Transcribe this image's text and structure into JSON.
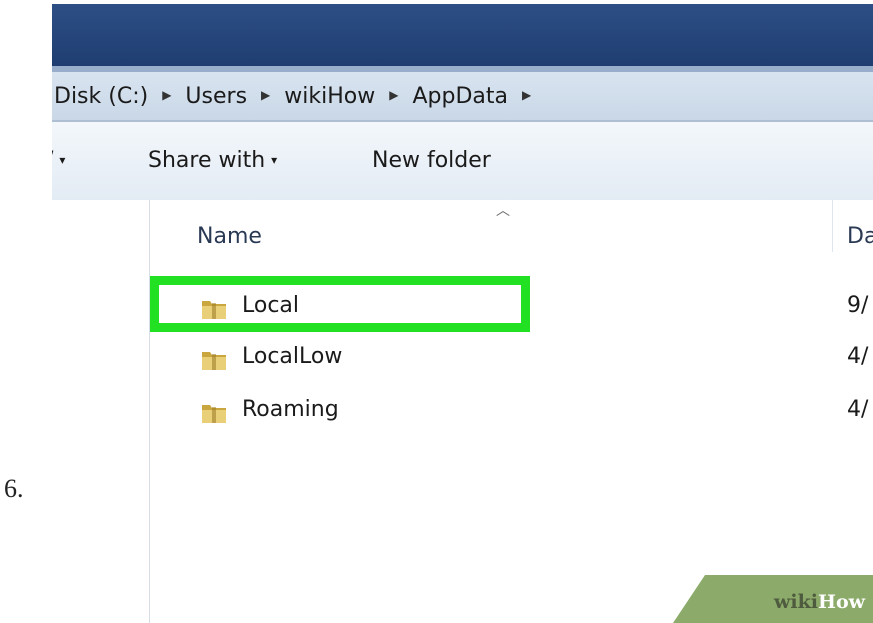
{
  "step": {
    "number": "6."
  },
  "address_bar": {
    "crumbs": [
      "Disk (C:)",
      "Users",
      "wikiHow",
      "AppData"
    ],
    "separator_icon": "triangle-right-icon"
  },
  "toolbar": {
    "cutoff_caret": "▾",
    "share_with_label": "Share with",
    "share_with_caret": "▾",
    "new_folder_label": "New folder"
  },
  "file_list": {
    "columns": {
      "name": "Name",
      "date_partial": "Da"
    },
    "sort_icon": "sort-ascending-icon",
    "rows": [
      {
        "name": "Local",
        "date_partial": "9/",
        "icon": "folder-icon",
        "highlighted": true
      },
      {
        "name": "LocalLow",
        "date_partial": "4/",
        "icon": "folder-icon",
        "highlighted": false
      },
      {
        "name": "Roaming",
        "date_partial": "4/",
        "icon": "folder-icon",
        "highlighted": false
      }
    ]
  },
  "highlight": {
    "color": "#22e122"
  },
  "watermark": {
    "wiki": "wiki",
    "how": "How",
    "color": "#8cab6a"
  },
  "colors": {
    "titlebar": "#2d4f86",
    "addressbar": "#d9e4f0",
    "toolbar": "#e9eff6"
  }
}
